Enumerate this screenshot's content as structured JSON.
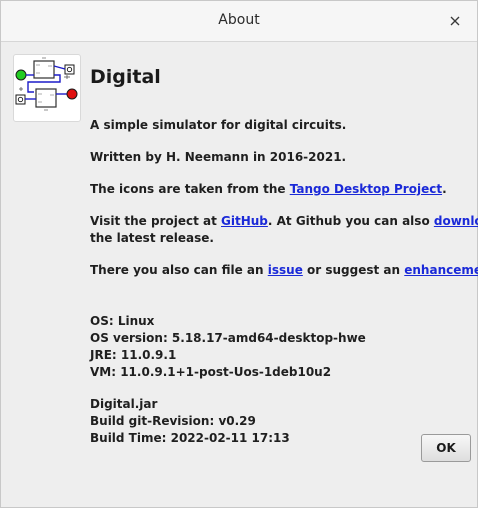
{
  "window": {
    "title": "About",
    "close_icon": "close-icon"
  },
  "app": {
    "name": "Digital",
    "logo_icon": "digital-circuit-logo-icon"
  },
  "about": {
    "description": "A simple simulator for digital circuits.",
    "written_by": "Written by H. Neemann in 2016-2021.",
    "icons_prefix": "The icons are taken from the ",
    "icons_link": "Tango Desktop Project",
    "icons_suffix": ".",
    "visit_prefix": "Visit the project at ",
    "github_link": "GitHub",
    "visit_middle": ". At Github you can also ",
    "download_link": "download",
    "visit_line2": "the latest release.",
    "issue_prefix": "There you also can file an ",
    "issue_link": "issue",
    "issue_middle": " or suggest an ",
    "enhancement_link": "enhancement",
    "issue_suffix": "."
  },
  "system": {
    "os": "OS: Linux",
    "os_version": "OS version: 5.18.17-amd64-desktop-hwe",
    "jre": "JRE: 11.0.9.1",
    "vm": "VM: 11.0.9.1+1-post-Uos-1deb10u2"
  },
  "build": {
    "jar": "Digital.jar",
    "revision": "Build git-Revision: v0.29",
    "time": "Build Time: 2022-02-11 17:13"
  },
  "buttons": {
    "ok_label": "OK"
  },
  "colors": {
    "link": "#1a29d8",
    "input_led": "#22cc22",
    "output_led": "#e01010"
  }
}
